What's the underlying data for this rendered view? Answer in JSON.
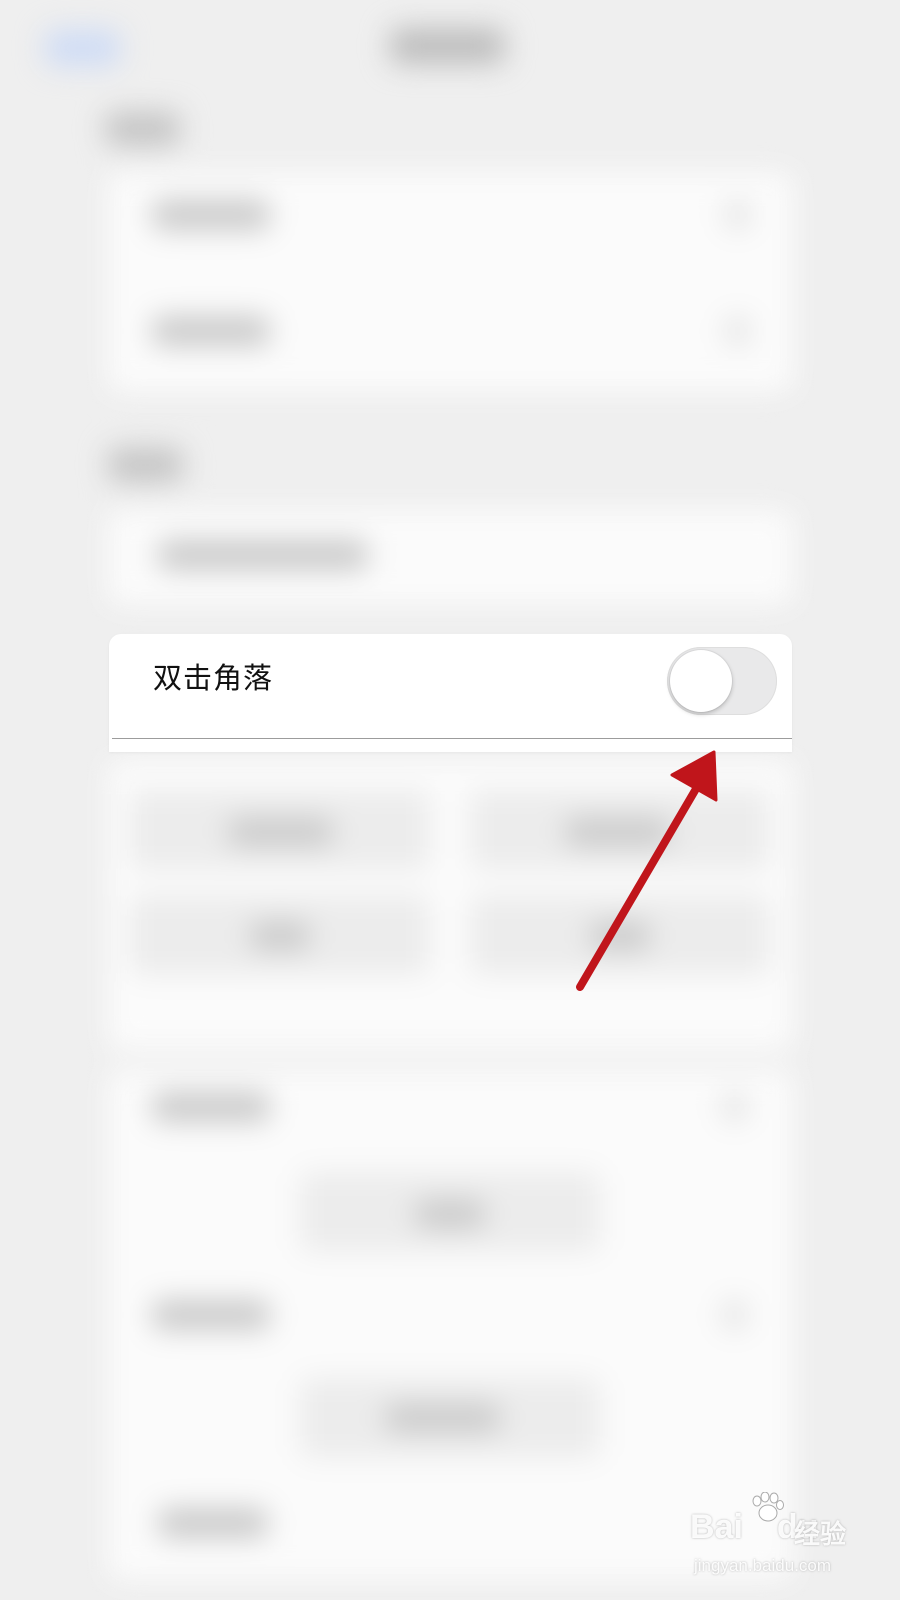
{
  "setting": {
    "label": "双击角落",
    "toggle_state": "off"
  },
  "colors": {
    "background": "#efefef",
    "card": "#ffffff",
    "toggle_track_off": "#e9e9ea",
    "annotation_arrow": "#c0151b"
  },
  "watermark": {
    "brand_left": "Bai",
    "brand_right": "du",
    "product": "经验",
    "url": "jingyan.baidu.com"
  }
}
